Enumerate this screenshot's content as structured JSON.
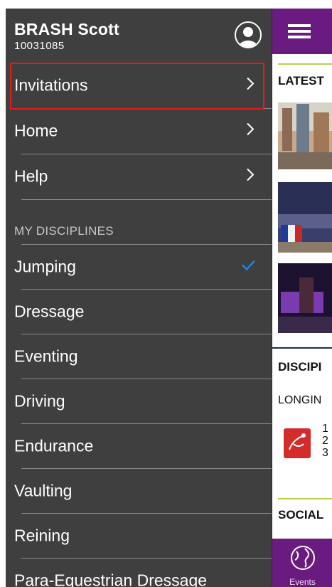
{
  "user": {
    "name": "BRASH Scott",
    "id": "10031085"
  },
  "menu": {
    "invitations": "Invitations",
    "home": "Home",
    "help": "Help",
    "section_header": "MY DISCIPLINES",
    "disciplines": [
      {
        "label": "Jumping",
        "selected": true
      },
      {
        "label": "Dressage",
        "selected": false
      },
      {
        "label": "Eventing",
        "selected": false
      },
      {
        "label": "Driving",
        "selected": false
      },
      {
        "label": "Endurance",
        "selected": false
      },
      {
        "label": "Vaulting",
        "selected": false
      },
      {
        "label": "Reining",
        "selected": false
      },
      {
        "label": "Para-Equestrian Dressage",
        "selected": false
      }
    ]
  },
  "background_app": {
    "latest_label": "LATEST",
    "disciplines_label": "DISCIPI",
    "longines_label": "LONGIN",
    "numbers": [
      "1",
      "2",
      "3"
    ],
    "social_label": "SOCIAL",
    "tab_events": "Events"
  },
  "colors": {
    "drawer_bg": "#3f3f3f",
    "accent_purple": "#6a1b80",
    "check_blue": "#1e88e5",
    "highlight_red": "#e01d1d",
    "accent_green": "#b7d24a"
  },
  "icons": {
    "avatar": "user-avatar-icon",
    "chevron": "chevron-right-icon",
    "check": "checkmark-icon",
    "menu": "hamburger-icon",
    "events": "globe-icon"
  }
}
